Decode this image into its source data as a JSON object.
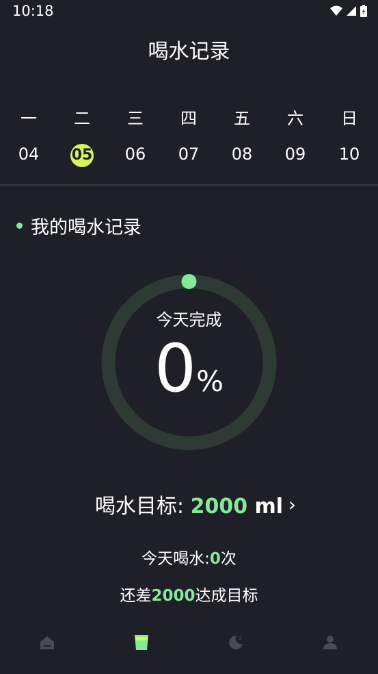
{
  "status_bar": {
    "time": "10:18"
  },
  "header": {
    "title": "喝水记录"
  },
  "week": {
    "days": [
      {
        "name": "一",
        "num": "04",
        "selected": false
      },
      {
        "name": "二",
        "num": "05",
        "selected": true
      },
      {
        "name": "三",
        "num": "06",
        "selected": false
      },
      {
        "name": "四",
        "num": "07",
        "selected": false
      },
      {
        "name": "五",
        "num": "08",
        "selected": false
      },
      {
        "name": "六",
        "num": "09",
        "selected": false
      },
      {
        "name": "日",
        "num": "10",
        "selected": false
      }
    ]
  },
  "section": {
    "title": "我的喝水记录"
  },
  "progress": {
    "label": "今天完成",
    "value": "0",
    "unit": "%",
    "fraction": 0
  },
  "goal": {
    "label": "喝水目标: ",
    "amount": "2000",
    "unit": " ml",
    "arrow": "›"
  },
  "today": {
    "prefix": "今天喝水:",
    "count": "0",
    "suffix": "次"
  },
  "remaining": {
    "prefix": "还差",
    "amount": "2000",
    "suffix": "达成目标"
  },
  "bottom_nav": {
    "items": [
      {
        "icon": "home-icon",
        "active": false
      },
      {
        "icon": "water-cup-icon",
        "active": true
      },
      {
        "icon": "sleep-moon-icon",
        "active": false
      },
      {
        "icon": "profile-icon",
        "active": false
      }
    ]
  },
  "colors": {
    "background": "#1f1f27",
    "accent_green": "#86e89a",
    "selected_day": "#d8f55a",
    "ring_track": "#2e3a34",
    "nav_inactive": "#4a4a55"
  }
}
